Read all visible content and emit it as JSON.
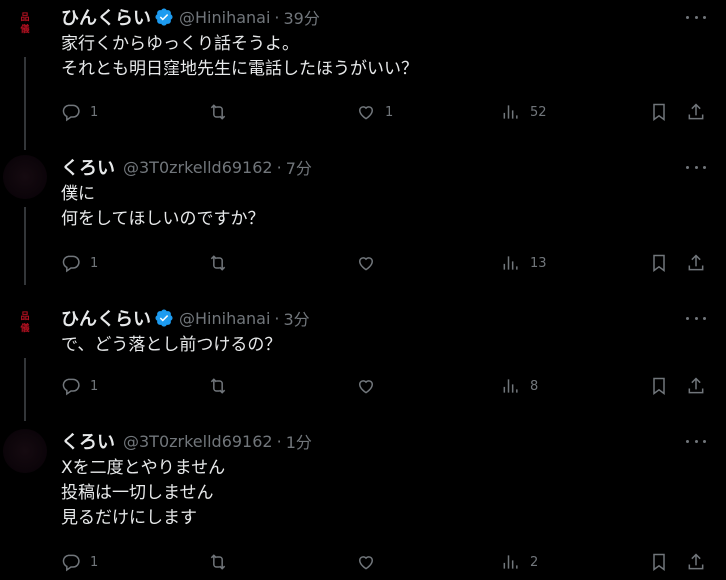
{
  "tweets": [
    {
      "name": "ひんくらい",
      "handle": "@Hinihanai",
      "time": "39分",
      "verified": true,
      "lines": [
        "家行くからゆっくり話そうよ。",
        "それとも明日窪地先生に電話したほうがいい？"
      ],
      "counts": {
        "reply": "1",
        "retweet": "",
        "like": "1",
        "views": "52"
      }
    },
    {
      "name": "くろい",
      "handle": "@3T0zrkelld69162",
      "time": "7分",
      "verified": false,
      "lines": [
        "僕に",
        "何をしてほしいのですか？"
      ],
      "counts": {
        "reply": "1",
        "retweet": "",
        "like": "",
        "views": "13"
      }
    },
    {
      "name": "ひんくらい",
      "handle": "@Hinihanai",
      "time": "3分",
      "verified": true,
      "lines": [
        "で、どう落とし前つけるの？"
      ],
      "counts": {
        "reply": "1",
        "retweet": "",
        "like": "",
        "views": "8"
      }
    },
    {
      "name": "くろい",
      "handle": "@3T0zrkelld69162",
      "time": "1分",
      "verified": false,
      "lines": [
        "Xを二度とやりません",
        "投稿は一切しません",
        "見るだけにします"
      ],
      "counts": {
        "reply": "1",
        "retweet": "",
        "like": "",
        "views": "2"
      }
    }
  ],
  "seal_text": "品 儀",
  "colors": {
    "background": "#000000",
    "text": "#e7e9ea",
    "muted": "#71767b",
    "verified": "#1d9bf0",
    "thread_line": "#333639",
    "seal": "#b01020"
  },
  "icons": [
    "reply-icon",
    "retweet-icon",
    "like-icon",
    "views-icon",
    "bookmark-icon",
    "share-icon",
    "more-icon",
    "verified-badge-icon"
  ]
}
